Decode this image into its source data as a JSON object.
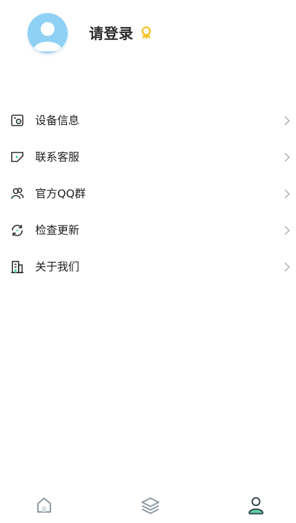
{
  "profile": {
    "login_text": "请登录",
    "avatar_icon": "user-avatar-placeholder",
    "badge_icon": "award-badge-icon",
    "colors": {
      "avatar_bg": "#8fd0f5",
      "badge": "#f4c430"
    }
  },
  "menu": {
    "items": [
      {
        "label": "设备信息",
        "icon": "device-info-icon"
      },
      {
        "label": "联系客服",
        "icon": "customer-service-icon"
      },
      {
        "label": "官方QQ群",
        "icon": "group-icon"
      },
      {
        "label": "检查更新",
        "icon": "refresh-icon"
      },
      {
        "label": "关于我们",
        "icon": "building-icon"
      }
    ]
  },
  "tabbar": {
    "tabs": [
      {
        "icon": "home-icon",
        "active": false
      },
      {
        "icon": "layers-icon",
        "active": false
      },
      {
        "icon": "profile-icon",
        "active": true
      }
    ],
    "colors": {
      "inactive": "#8a96a3",
      "active_accent": "#5dd6a0",
      "active_stroke": "#3a4350"
    }
  }
}
